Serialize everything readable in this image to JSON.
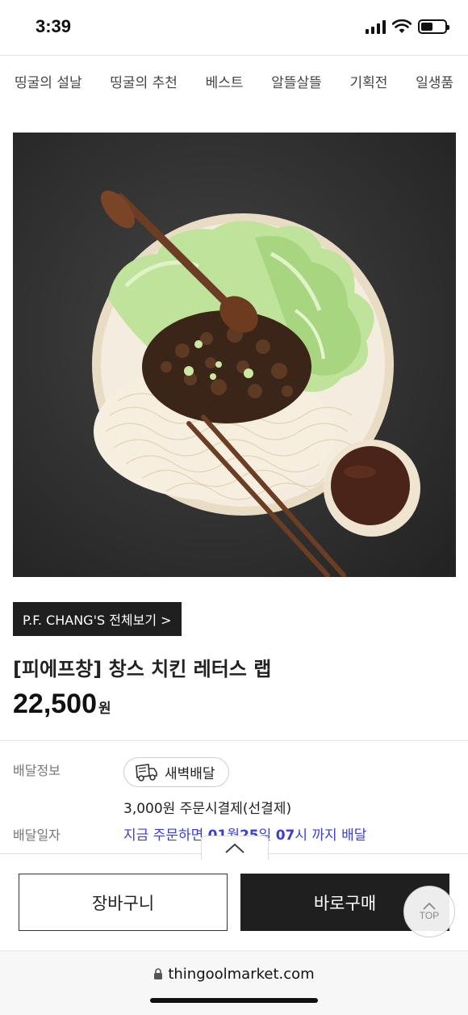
{
  "status_bar": {
    "time": "3:39",
    "battery_level": 0.5
  },
  "nav": {
    "items": [
      "띵굴의 설날",
      "띵굴의 추천",
      "베스트",
      "알뜰살뜰",
      "기획전",
      "일생품"
    ]
  },
  "product": {
    "brand_link": "P.F. CHANG'S 전체보기 >",
    "title": "[피에프창] 창스 치킨 레터스 랩",
    "price": "22,500",
    "price_unit": "원"
  },
  "delivery": {
    "info_label": "배달정보",
    "badge": "새벽배달",
    "fee": "3,000원 주문시결제(선결제)",
    "date_label": "배달일자",
    "date_parts": [
      "지금 주문하면 ",
      "01",
      "월",
      "25",
      "일 ",
      "07",
      "시 까지 배달"
    ]
  },
  "actions": {
    "cart": "장바구니",
    "buy": "바로구매",
    "top": "TOP"
  },
  "browser": {
    "url": "thingoolmarket.com"
  }
}
